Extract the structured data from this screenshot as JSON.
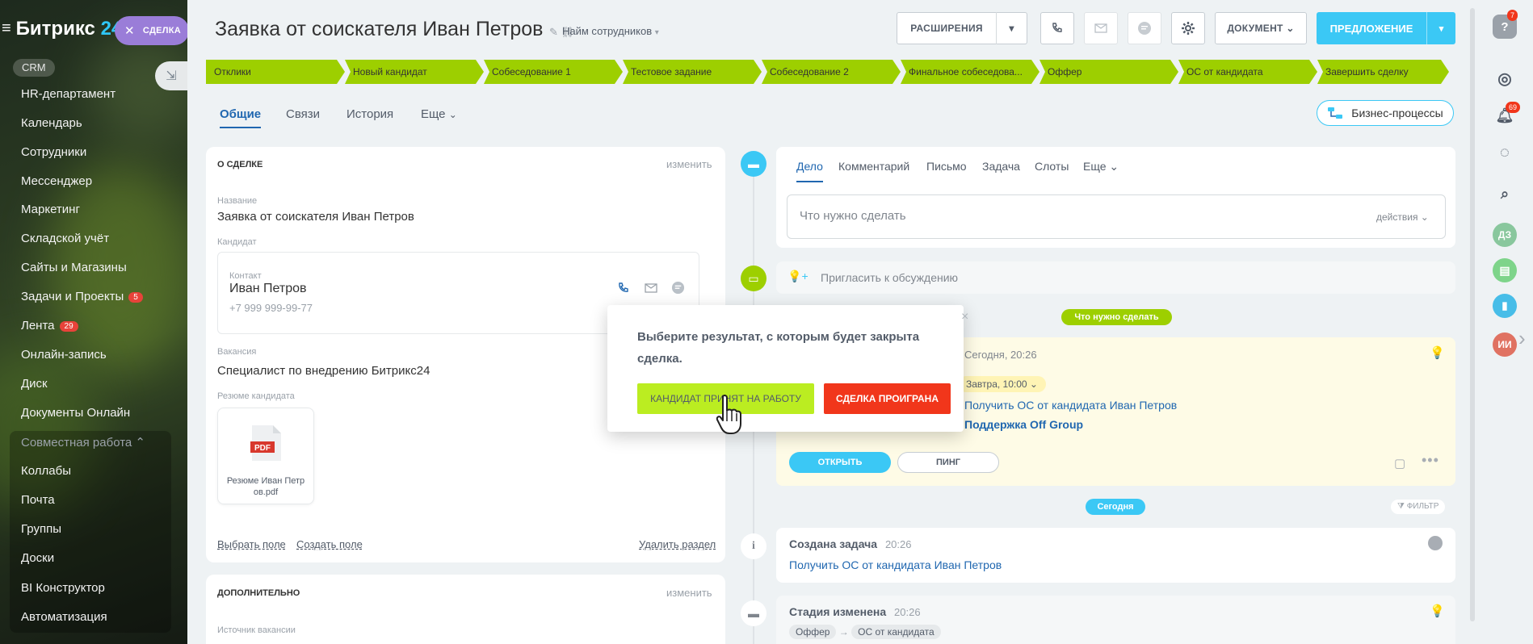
{
  "sidebar": {
    "logo": "Битрикс",
    "logo_num": "24",
    "deal_chip": "СДЕЛКА",
    "crm_pill": "CRM",
    "items": [
      {
        "label": "HR-департамент"
      },
      {
        "label": "Календарь"
      },
      {
        "label": "Сотрудники"
      },
      {
        "label": "Мессенджер"
      },
      {
        "label": "Маркетинг"
      },
      {
        "label": "Складской учёт"
      },
      {
        "label": "Сайты и Магазины"
      },
      {
        "label": "Задачи и Проекты",
        "badge": "5"
      },
      {
        "label": "Лента",
        "badge": "29"
      },
      {
        "label": "Онлайн-запись"
      },
      {
        "label": "Диск"
      },
      {
        "label": "Документы Онлайн"
      },
      {
        "label": "Совместная работа"
      },
      {
        "label": "Коллабы"
      },
      {
        "label": "Почта"
      },
      {
        "label": "Группы"
      },
      {
        "label": "Доски"
      },
      {
        "label": "BI Конструктор"
      },
      {
        "label": "Автоматизация"
      }
    ]
  },
  "header": {
    "title": "Заявка от соискателя Иван Петров",
    "category": "Найм сотрудников",
    "btn_extensions": "РАСШИРЕНИЯ",
    "btn_document": "ДОКУМЕНТ",
    "btn_offer": "ПРЕДЛОЖЕНИЕ"
  },
  "stages": [
    "Отклики",
    "Новый кандидат",
    "Собеседование 1",
    "Тестовое задание",
    "Собеседование 2",
    "Финальное собеседова...",
    "Оффер",
    "ОС от кандидата",
    "Завершить сделку"
  ],
  "tabs": [
    "Общие",
    "Связи",
    "История",
    "Еще"
  ],
  "bp_button": "Бизнес-процессы",
  "about": {
    "header": "О СДЕЛКЕ",
    "edit": "изменить",
    "name_label": "Название",
    "name_value": "Заявка от соискателя Иван Петров",
    "candidate_label": "Кандидат",
    "contact_label": "Контакт",
    "contact_name": "Иван Петров",
    "contact_phone": "+7 999 999-99-77",
    "vacancy_label": "Вакансия",
    "vacancy_value": "Специалист по внедрению Битрикс24",
    "resume_label": "Резюме кандидата",
    "file_badge": "PDF",
    "file_name": "Резюме Иван Петр ов.pdf",
    "select_field": "Выбрать поле",
    "create_field": "Создать поле",
    "delete_section": "Удалить раздел"
  },
  "extra": {
    "header": "ДОПОЛНИТЕЛЬНО",
    "edit": "изменить",
    "source_label": "Источник вакансии"
  },
  "composer": {
    "tabs": [
      "Дело",
      "Комментарий",
      "Письмо",
      "Задача",
      "Слоты",
      "Еще"
    ],
    "placeholder": "Что нужно сделать",
    "actions": "действия",
    "invite": "Пригласить к обсуждению"
  },
  "timeline": {
    "todo_pill": "Что нужно сделать",
    "task_time": "Сегодня, 20:26",
    "deadline": "Завтра, 10:00",
    "task_text": "Получить ОС от кандидата Иван Петров",
    "task_company": "Поддержка Off Group",
    "btn_open": "ОТКРЫТЬ",
    "btn_ping": "ПИНГ",
    "today_pill": "Сегодня",
    "filter": "ФИЛЬТР",
    "created_title": "Создана задача",
    "created_time": "20:26",
    "created_text": "Получить ОС от кандидата Иван Петров",
    "stage_title": "Стадия изменена",
    "stage_time": "20:26",
    "stage_from": "Оффер",
    "stage_to": "ОС от кандидата"
  },
  "popup": {
    "text": "Выберите результат, с которым будет закрыта сделка.",
    "btn_success": "КАНДИДАТ ПРИНЯТ НА РАБОТУ",
    "btn_fail": "СДЕЛКА ПРОИГРАНА"
  },
  "rightbar": {
    "help_badge": "7",
    "bell_badge": "69",
    "avatar1": "ДЗ",
    "avatar2": "ИИ"
  },
  "colors": {
    "stage": "#9dcf00",
    "accent": "#3bc8f5",
    "success_btn": "#bbed21",
    "fail_btn": "#f1361b"
  }
}
